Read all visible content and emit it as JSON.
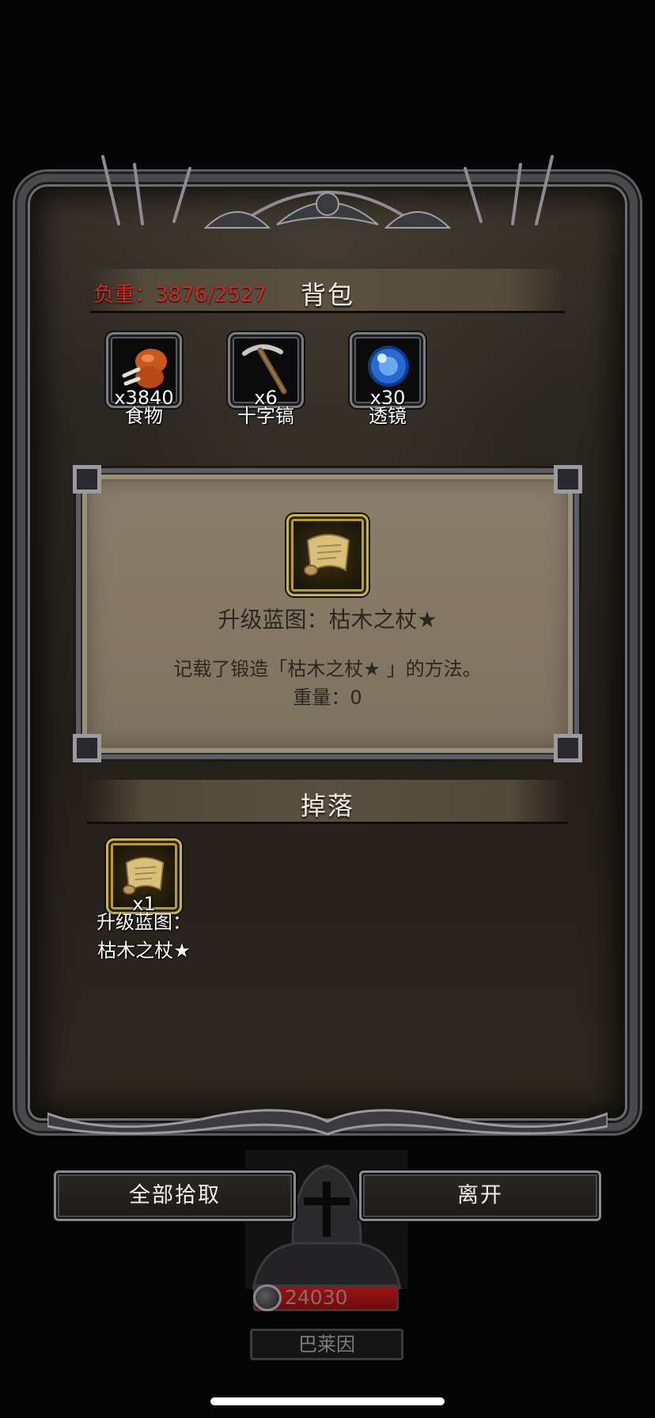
{
  "backpack": {
    "title": "背包",
    "weight_label": "负重：3876/2527",
    "items": [
      {
        "name": "食物",
        "qty": "x3840",
        "icon": "meat-icon"
      },
      {
        "name": "十字镐",
        "qty": "x6",
        "icon": "pickaxe-icon"
      },
      {
        "name": "透镜",
        "qty": "x30",
        "icon": "lens-orb-icon"
      }
    ]
  },
  "detail": {
    "title": "升级蓝图：枯木之杖★",
    "description": "记载了锻造「枯木之杖★ 」的方法。",
    "weight": "重量：0",
    "icon": "scroll-icon"
  },
  "loot": {
    "title": "掉落",
    "items": [
      {
        "name_line1": "升级蓝图：",
        "name_line2": "枯木之杖★",
        "qty": "x1",
        "icon": "scroll-icon"
      }
    ]
  },
  "buttons": {
    "take_all": "全部拾取",
    "leave": "离开"
  },
  "hero": {
    "power": "24030",
    "name": "巴莱因"
  },
  "colors": {
    "weight_warning": "#d02a22",
    "panel_parchment": "#857966",
    "frame_metal": "#6d6d72"
  }
}
